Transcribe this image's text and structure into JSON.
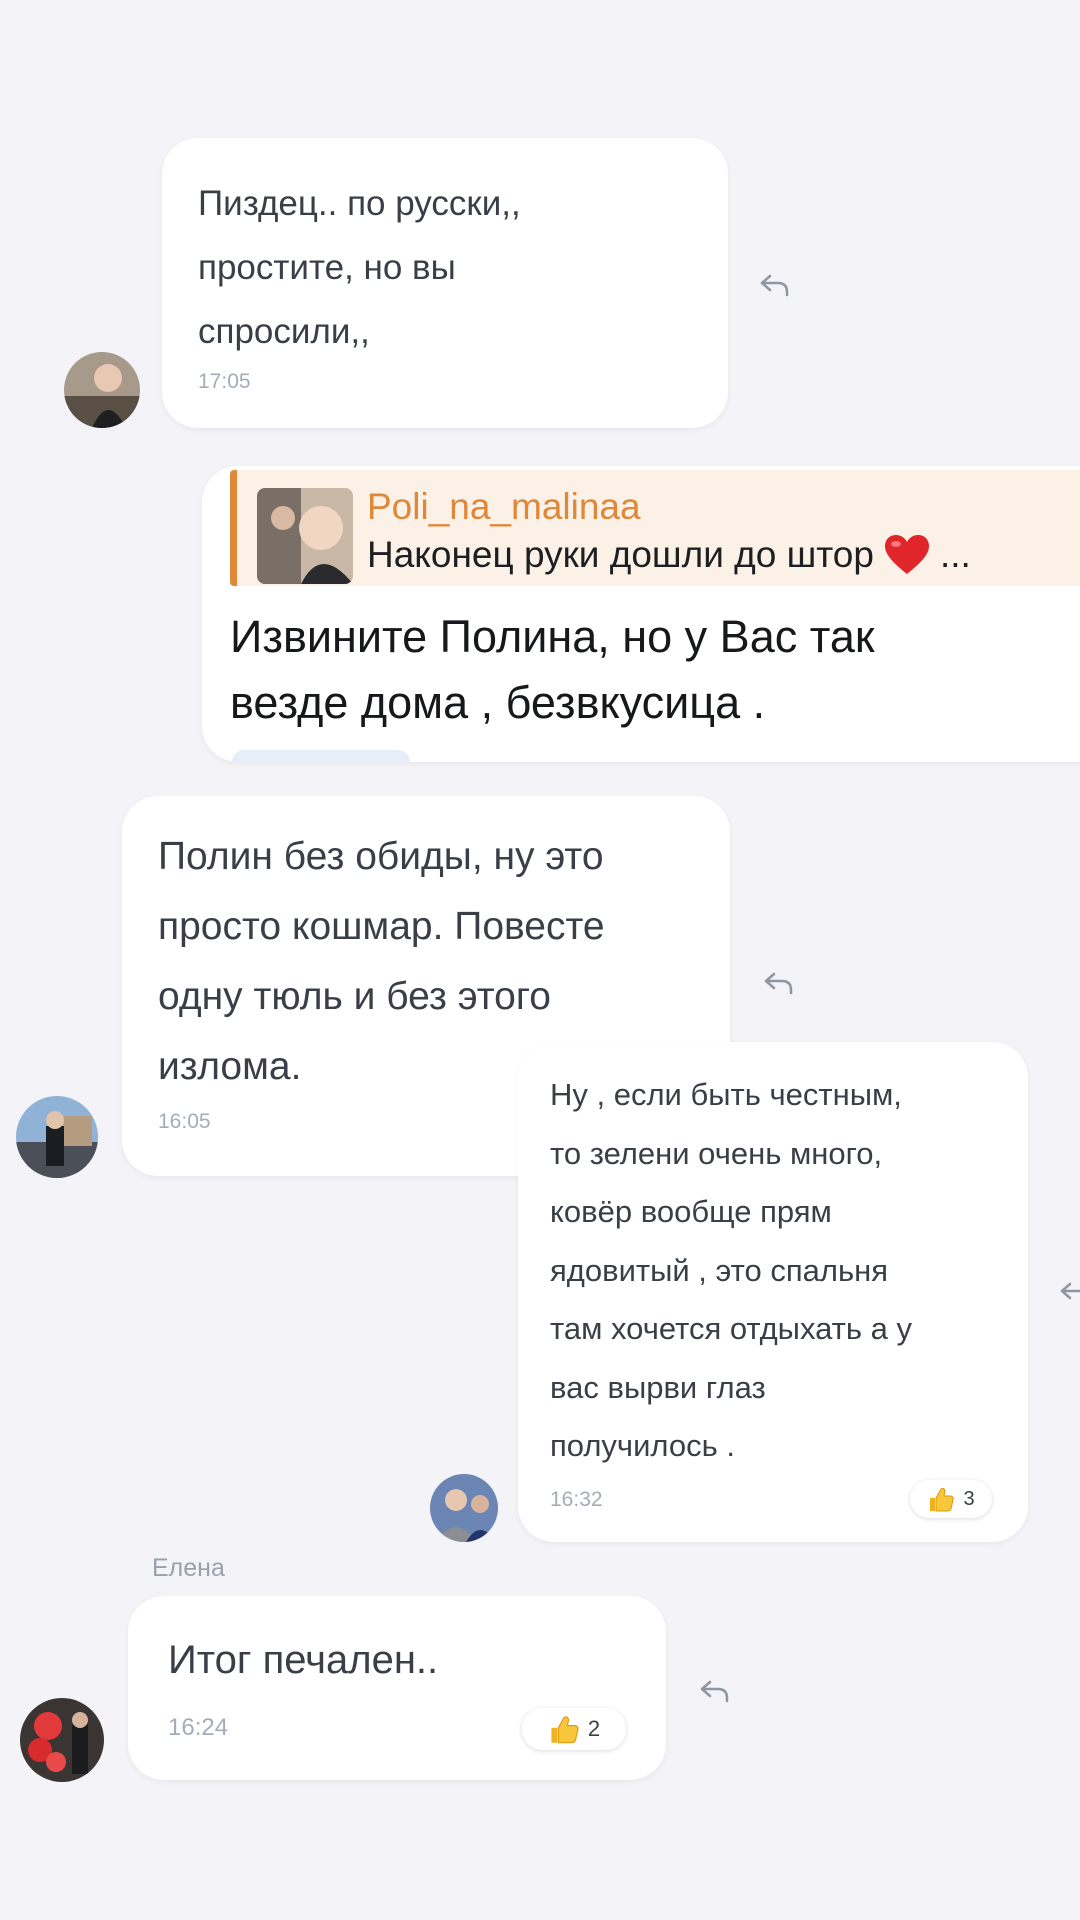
{
  "messages": [
    {
      "text": "Пиздец.. по русски,,\nпростите, но вы\nспросили,,",
      "time": "17:05"
    },
    {
      "quote_author": "Poli_na_malinaa",
      "quote_text": "Наконец руки дошли до штор",
      "quote_ellipsis": "...",
      "text": "Извините Полина, но у Вас так\nвезде дома , безвкусица ."
    },
    {
      "text": "Полин без обиды, ну это\nпросто кошмар. Повесте\nодну тюль и без этого\nизлома.",
      "time": "16:05"
    },
    {
      "text": "Ну , если быть честным,\nто зелени очень много,\nковёр вообще прям\nядовитый , это спальня\nтам хочется отдыхать а у\nвас вырви глаз\nполучилось .",
      "time": "16:32",
      "reaction_count": "3"
    },
    {
      "sender": "Елена",
      "text": "Итог печален..",
      "time": "16:24",
      "reaction_count": "2"
    }
  ],
  "icons": {
    "reply": "reply-arrow-icon",
    "reaction": "thumbs-up-icon",
    "heart": "red-heart-icon"
  },
  "colors": {
    "background": "#f3f3f8",
    "quote_accent": "#e0883a",
    "quote_author": "#e0883a"
  }
}
